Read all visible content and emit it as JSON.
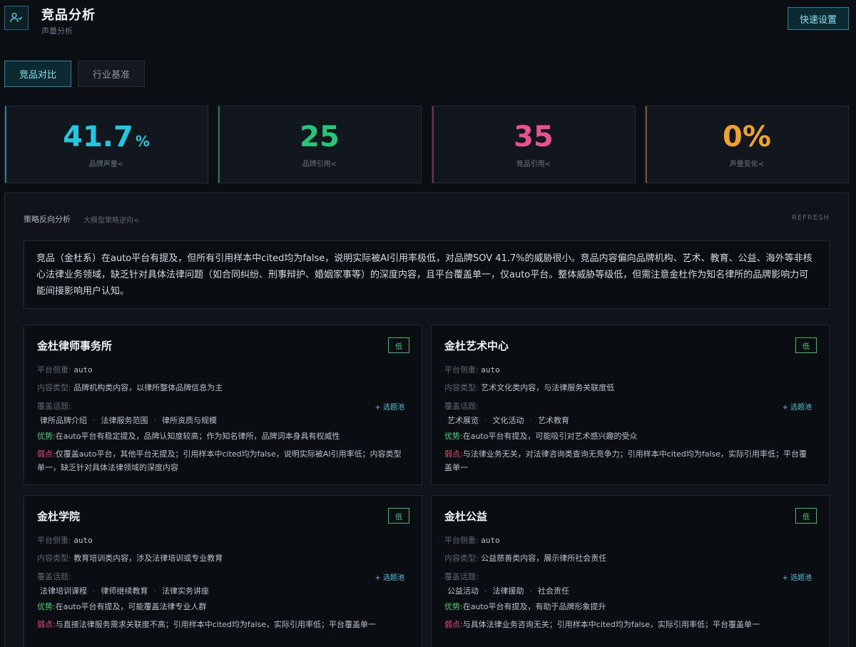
{
  "header": {
    "icon": "user-check-icon",
    "title": "竞品分析",
    "subtitle": "声量分析",
    "quick_settings": "快速设置"
  },
  "tabs": [
    {
      "label": "竞品对比",
      "active": true
    },
    {
      "label": "行业基准",
      "active": false
    }
  ],
  "stats": [
    {
      "value": "41.7",
      "unit": "%",
      "label": "品牌声量<",
      "color": "#22c7e0",
      "bar": "#1d7e8c"
    },
    {
      "value": "25",
      "unit": "",
      "label": "品牌引用<",
      "color": "#22c77a",
      "bar": "#1f7a52"
    },
    {
      "value": "35",
      "unit": "",
      "label": "竞品引用<",
      "color": "#e8528e",
      "bar": "#7a2d4c"
    },
    {
      "value": "0%",
      "unit": "",
      "label": "声量变化<",
      "color": "#f0a22e",
      "bar": "#7a5420"
    }
  ],
  "analysis": {
    "title": "策略反向分析",
    "subtitle": "大模型策略逆向<",
    "refresh": "REFRESH",
    "summary": "竞品（金杜系）在auto平台有提及，但所有引用样本中cited均为false，说明实际被AI引用率极低，对品牌SOV 41.7%的威胁很小。竞品内容偏向品牌机构、艺术、教育、公益、海外等非核心法律业务领域，缺乏针对具体法律问题（如合同纠纷、刑事辩护、婚姻家事等）的深度内容，且平台覆盖单一，仅auto平台。整体威胁等级低，但需注意金杜作为知名律所的品牌影响力可能间接影响用户认知。"
  },
  "labels": {
    "platform": "平台侧重:",
    "content_type": "内容类型:",
    "topics": "覆盖话题:",
    "pool": "+ 选题池",
    "advantage": "优势:",
    "weakness": "弱点:"
  },
  "competitors": [
    {
      "name": "金杜律师事务所",
      "level": "低",
      "platform": "auto",
      "content_type": "品牌机构类内容，以律所整体品牌信息为主",
      "topics": [
        "律所品牌介绍",
        "法律服务范围",
        "律所资质与规模"
      ],
      "advantage": "在auto平台有稳定提及，品牌认知度较高；作为知名律所，品牌词本身具有权威性",
      "weakness": "仅覆盖auto平台，其他平台无提及；引用样本中cited均为false，说明实际被AI引用率低；内容类型单一，缺乏针对具体法律领域的深度内容"
    },
    {
      "name": "金杜艺术中心",
      "level": "低",
      "platform": "auto",
      "content_type": "艺术文化类内容，与法律服务关联度低",
      "topics": [
        "艺术展览",
        "文化活动",
        "艺术教育"
      ],
      "advantage": "在auto平台有提及，可能吸引对艺术感兴趣的受众",
      "weakness": "与法律业务无关，对法律咨询类查询无竞争力；引用样本中cited均为false，实际引用率低；平台覆盖单一"
    },
    {
      "name": "金杜学院",
      "level": "低",
      "platform": "auto",
      "content_type": "教育培训类内容，涉及法律培训或专业教育",
      "topics": [
        "法律培训课程",
        "律师继续教育",
        "法律实务讲座"
      ],
      "advantage": "在auto平台有提及，可能覆盖法律专业人群",
      "weakness": "与直接法律服务需求关联度不高；引用样本中cited均为false，实际引用率低；平台覆盖单一"
    },
    {
      "name": "金杜公益",
      "level": "低",
      "platform": "auto",
      "content_type": "公益慈善类内容，展示律所社会责任",
      "topics": [
        "公益活动",
        "法律援助",
        "社会责任"
      ],
      "advantage": "在auto平台有提及，有助于品牌形象提升",
      "weakness": "与具体法律业务咨询无关；引用样本中cited均为false，实际引用率低；平台覆盖单一"
    }
  ]
}
